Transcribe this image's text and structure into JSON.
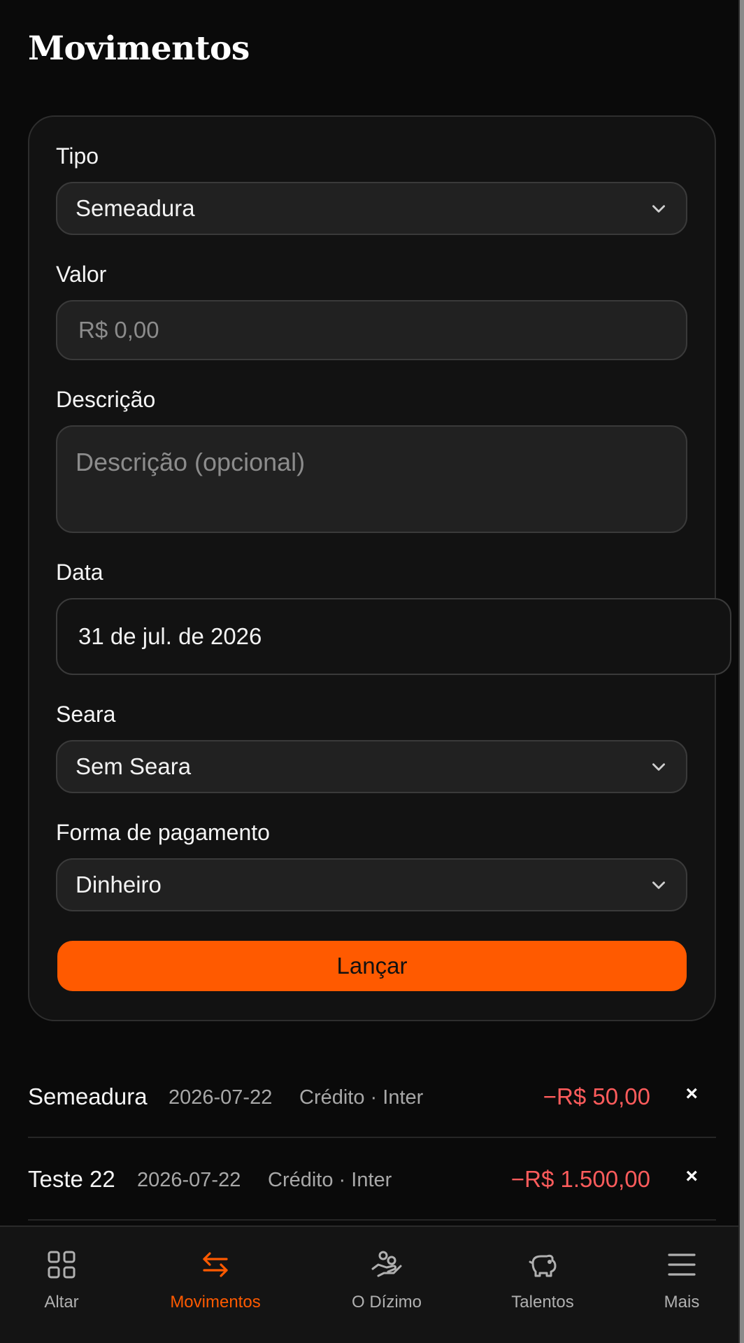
{
  "page_title": "Movimentos",
  "form": {
    "tipo": {
      "label": "Tipo",
      "value": "Semeadura"
    },
    "valor": {
      "label": "Valor",
      "placeholder": "R$ 0,00"
    },
    "descricao": {
      "label": "Descrição",
      "placeholder": "Descrição (opcional)"
    },
    "data": {
      "label": "Data",
      "value": "31 de jul. de 2026"
    },
    "seara": {
      "label": "Seara",
      "value": "Sem Seara"
    },
    "pagamento": {
      "label": "Forma de pagamento",
      "value": "Dinheiro"
    },
    "submit_label": "Lançar"
  },
  "transactions": [
    {
      "name": "Semeadura",
      "date": "2026-07-22",
      "meta": "Crédito · Inter",
      "amount": "−R$ 50,00",
      "delete": "×"
    },
    {
      "name": "Teste 22",
      "date": "2026-07-22",
      "meta": "Crédito · Inter",
      "amount": "−R$ 1.500,00",
      "delete": "×"
    }
  ],
  "nav": [
    {
      "label": "Altar",
      "icon": "grid-icon",
      "active": false
    },
    {
      "label": "Movimentos",
      "icon": "swap-arrows-icon",
      "active": true
    },
    {
      "label": "O Dízimo",
      "icon": "hand-giving-icon",
      "active": false
    },
    {
      "label": "Talentos",
      "icon": "piggy-bank-icon",
      "active": false
    },
    {
      "label": "Mais",
      "icon": "menu-icon",
      "active": false
    }
  ],
  "colors": {
    "accent": "#ff5a00",
    "negative_amount": "#ff5c5c",
    "background": "#0a0a0a",
    "card": "#121212",
    "field": "#212121"
  }
}
